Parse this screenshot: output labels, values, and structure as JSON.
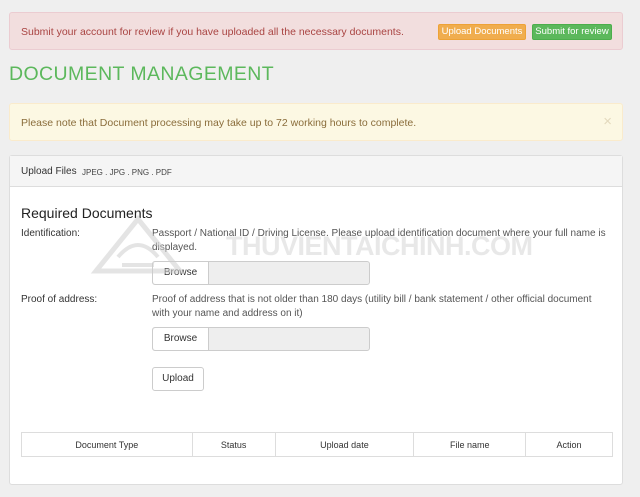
{
  "review_alert": {
    "message": "Submit your account for review if you have uploaded all the necessary documents.",
    "upload_button": "Upload Documents",
    "submit_button": "Submit for review"
  },
  "page": {
    "title": "DOCUMENT MANAGEMENT"
  },
  "processing_alert": {
    "message": "Please note that Document processing may take up to 72 working hours to complete.",
    "close_glyph": "×"
  },
  "upload_panel": {
    "heading": "Upload Files",
    "formats": "JPEG . JPG . PNG . PDF",
    "required_title": "Required Documents",
    "identification": {
      "label": "Identification:",
      "description": "Passport / National ID / Driving License. Please upload identification document where your full name is displayed.",
      "browse_label": "Browse"
    },
    "proof_of_address": {
      "label": "Proof of address:",
      "description": "Proof of address that is not older than 180 days (utility bill / bank statement / other official document with your name and address on it)",
      "browse_label": "Browse"
    },
    "upload_button": "Upload"
  },
  "documents_table": {
    "columns": [
      "Document Type",
      "Status",
      "Upload date",
      "File name",
      "Action"
    ]
  },
  "watermark": {
    "text": "THUVIENTAICHINH.COM"
  },
  "colors": {
    "danger_bg": "#f2dede",
    "danger_text": "#a94442",
    "warning_bg": "#fcf8e3",
    "warning_text": "#8a6d3b",
    "title_green": "#5cb85c",
    "upload_docs_orange": "#f0ad4e",
    "submit_green": "#5cb85c"
  }
}
